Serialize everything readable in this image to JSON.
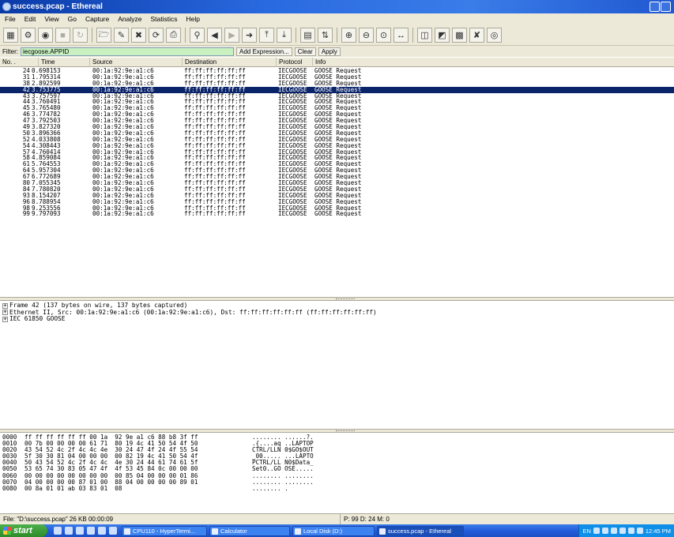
{
  "window": {
    "title": "success.pcap - Ethereal"
  },
  "menu": [
    "File",
    "Edit",
    "View",
    "Go",
    "Capture",
    "Analyze",
    "Statistics",
    "Help"
  ],
  "toolbar": {
    "icons": [
      "interface-list-icon",
      "capture-options-icon",
      "start-capture-icon",
      "stop-capture-icon",
      "restart-capture-icon",
      "open-icon",
      "save-as-icon",
      "close-file-icon",
      "reload-icon",
      "print-icon",
      "find-packet-icon",
      "go-back-icon",
      "go-forward-icon",
      "go-to-packet-icon",
      "go-first-icon",
      "go-last-icon",
      "colorize-icon",
      "auto-scroll-icon",
      "zoom-in-icon",
      "zoom-out-icon",
      "zoom-normal-icon",
      "resize-columns-icon",
      "capture-filters-icon",
      "display-filters-icon",
      "coloring-rules-icon",
      "preferences-icon",
      "help-icon"
    ]
  },
  "filter": {
    "label": "Filter:",
    "value": "iecgoose.APPID",
    "add_expression": "Add Expression...",
    "clear": "Clear",
    "apply": "Apply"
  },
  "columns": [
    "No. .",
    "Time",
    "Source",
    "Destination",
    "Protocol",
    "Info"
  ],
  "packets": [
    {
      "no": "24",
      "time": "0.698153",
      "src": "00:1a:92:9e:a1:c6",
      "dst": "ff:ff:ff:ff:ff:ff",
      "proto": "IECGOOSE",
      "info": "GOOSE Request",
      "selected": false
    },
    {
      "no": "31",
      "time": "1.795314",
      "src": "00:1a:92:9e:a1:c6",
      "dst": "ff:ff:ff:ff:ff:ff",
      "proto": "IECGOOSE",
      "info": "GOOSE Request",
      "selected": false
    },
    {
      "no": "38",
      "time": "2.892599",
      "src": "00:1a:92:9e:a1:c6",
      "dst": "ff:ff:ff:ff:ff:ff",
      "proto": "IECGOOSE",
      "info": "GOOSE Request",
      "selected": false
    },
    {
      "no": "42",
      "time": "3.753775",
      "src": "00:1a:92:9e:a1:c6",
      "dst": "ff:ff:ff:ff:ff:ff",
      "proto": "IECGOOSE",
      "info": "GOOSE Request",
      "selected": true
    },
    {
      "no": "43",
      "time": "3.757597",
      "src": "00:1a:92:9e:a1:c6",
      "dst": "ff:ff:ff:ff:ff:ff",
      "proto": "IECGOOSE",
      "info": "GOOSE Request",
      "selected": false
    },
    {
      "no": "44",
      "time": "3.760491",
      "src": "00:1a:92:9e:a1:c6",
      "dst": "ff:ff:ff:ff:ff:ff",
      "proto": "IECGOOSE",
      "info": "GOOSE Request",
      "selected": false
    },
    {
      "no": "45",
      "time": "3.765480",
      "src": "00:1a:92:9e:a1:c6",
      "dst": "ff:ff:ff:ff:ff:ff",
      "proto": "IECGOOSE",
      "info": "GOOSE Request",
      "selected": false
    },
    {
      "no": "46",
      "time": "3.774782",
      "src": "00:1a:92:9e:a1:c6",
      "dst": "ff:ff:ff:ff:ff:ff",
      "proto": "IECGOOSE",
      "info": "GOOSE Request",
      "selected": false
    },
    {
      "no": "47",
      "time": "3.792503",
      "src": "00:1a:92:9e:a1:c6",
      "dst": "ff:ff:ff:ff:ff:ff",
      "proto": "IECGOOSE",
      "info": "GOOSE Request",
      "selected": false
    },
    {
      "no": "49",
      "time": "3.827320",
      "src": "00:1a:92:9e:a1:c6",
      "dst": "ff:ff:ff:ff:ff:ff",
      "proto": "IECGOOSE",
      "info": "GOOSE Request",
      "selected": false
    },
    {
      "no": "50",
      "time": "3.896366",
      "src": "00:1a:92:9e:a1:c6",
      "dst": "ff:ff:ff:ff:ff:ff",
      "proto": "IECGOOSE",
      "info": "GOOSE Request",
      "selected": false
    },
    {
      "no": "52",
      "time": "4.033808",
      "src": "00:1a:92:9e:a1:c6",
      "dst": "ff:ff:ff:ff:ff:ff",
      "proto": "IECGOOSE",
      "info": "GOOSE Request",
      "selected": false
    },
    {
      "no": "54",
      "time": "4.308443",
      "src": "00:1a:92:9e:a1:c6",
      "dst": "ff:ff:ff:ff:ff:ff",
      "proto": "IECGOOSE",
      "info": "GOOSE Request",
      "selected": false
    },
    {
      "no": "57",
      "time": "4.760414",
      "src": "00:1a:92:9e:a1:c6",
      "dst": "ff:ff:ff:ff:ff:ff",
      "proto": "IECGOOSE",
      "info": "GOOSE Request",
      "selected": false
    },
    {
      "no": "58",
      "time": "4.859084",
      "src": "00:1a:92:9e:a1:c6",
      "dst": "ff:ff:ff:ff:ff:ff",
      "proto": "IECGOOSE",
      "info": "GOOSE Request",
      "selected": false
    },
    {
      "no": "61",
      "time": "5.764553",
      "src": "00:1a:92:9e:a1:c6",
      "dst": "ff:ff:ff:ff:ff:ff",
      "proto": "IECGOOSE",
      "info": "GOOSE Request",
      "selected": false
    },
    {
      "no": "64",
      "time": "5.957304",
      "src": "00:1a:92:9e:a1:c6",
      "dst": "ff:ff:ff:ff:ff:ff",
      "proto": "IECGOOSE",
      "info": "GOOSE Request",
      "selected": false
    },
    {
      "no": "67",
      "time": "6.772689",
      "src": "00:1a:92:9e:a1:c6",
      "dst": "ff:ff:ff:ff:ff:ff",
      "proto": "IECGOOSE",
      "info": "GOOSE Request",
      "selected": false
    },
    {
      "no": "80",
      "time": "7.055345",
      "src": "00:1a:92:9e:a1:c6",
      "dst": "ff:ff:ff:ff:ff:ff",
      "proto": "IECGOOSE",
      "info": "GOOSE Request",
      "selected": false
    },
    {
      "no": "84",
      "time": "7.780820",
      "src": "00:1a:92:9e:a1:c6",
      "dst": "ff:ff:ff:ff:ff:ff",
      "proto": "IECGOOSE",
      "info": "GOOSE Request",
      "selected": false
    },
    {
      "no": "93",
      "time": "8.154207",
      "src": "00:1a:92:9e:a1:c6",
      "dst": "ff:ff:ff:ff:ff:ff",
      "proto": "IECGOOSE",
      "info": "GOOSE Request",
      "selected": false
    },
    {
      "no": "96",
      "time": "8.788954",
      "src": "00:1a:92:9e:a1:c6",
      "dst": "ff:ff:ff:ff:ff:ff",
      "proto": "IECGOOSE",
      "info": "GOOSE Request",
      "selected": false
    },
    {
      "no": "98",
      "time": "9.253556",
      "src": "00:1a:92:9e:a1:c6",
      "dst": "ff:ff:ff:ff:ff:ff",
      "proto": "IECGOOSE",
      "info": "GOOSE Request",
      "selected": false
    },
    {
      "no": "99",
      "time": "9.797093",
      "src": "00:1a:92:9e:a1:c6",
      "dst": "ff:ff:ff:ff:ff:ff",
      "proto": "IECGOOSE",
      "info": "GOOSE Request",
      "selected": false
    }
  ],
  "details": [
    {
      "expander": "⊞",
      "text": "Frame 42 (137 bytes on wire, 137 bytes captured)"
    },
    {
      "expander": "⊞",
      "text": "Ethernet II, Src: 00:1a:92:9e:a1:c6 (00:1a:92:9e:a1:c6), Dst: ff:ff:ff:ff:ff:ff (ff:ff:ff:ff:ff:ff)"
    },
    {
      "expander": "⊞",
      "text": "IEC 61850 GOOSE"
    }
  ],
  "bytes": [
    {
      "offset": "0000",
      "hex": "ff ff ff ff ff ff 00 1a  92 9e a1 c6 88 b8 3f ff",
      "ascii": "........ ......?."
    },
    {
      "offset": "0010",
      "hex": "00 7b 00 00 00 00 61 71  80 19 4c 41 50 54 4f 50",
      "ascii": ".{....aq ..LAPTOP"
    },
    {
      "offset": "0020",
      "hex": "43 54 52 4c 2f 4c 4c 4e  30 24 47 4f 24 4f 55 54",
      "ascii": "CTRL/LLN 0$GO$OUT"
    },
    {
      "offset": "0030",
      "hex": "5f 30 30 81 04 00 00 00  00 82 19 4c 41 50 54 4f",
      "ascii": "_00..... ...LAPTO"
    },
    {
      "offset": "0040",
      "hex": "50 43 54 52 4c 2f 4c 4c  4e 30 24 44 61 74 61 5f",
      "ascii": "PCTRL/LL N0$Data_"
    },
    {
      "offset": "0050",
      "hex": "53 65 74 30 83 05 47 4f  4f 53 45 84 0c 00 00 00",
      "ascii": "Set0..GO OSE....."
    },
    {
      "offset": "0060",
      "hex": "00 00 00 00 00 00 00 00  00 85 04 00 00 00 01 86",
      "ascii": "........ ........"
    },
    {
      "offset": "0070",
      "hex": "04 00 00 00 00 87 01 00  88 04 00 00 00 00 89 01",
      "ascii": "........ ........"
    },
    {
      "offset": "0080",
      "hex": "00 8a 01 01 ab 03 83 01  08",
      "ascii": "........ ."
    }
  ],
  "status": {
    "file": "File: \"D:\\success.pcap\" 26 KB 00:00:09",
    "counts": "P: 99 D: 24 M: 0"
  },
  "taskbar": {
    "start": "start",
    "tasks": [
      {
        "label": "CPU110 - HyperTermi...",
        "active": false
      },
      {
        "label": "Calculator",
        "active": false
      },
      {
        "label": "Local Disk (D:)",
        "active": false
      },
      {
        "label": "success.pcap - Ethereal",
        "active": true
      }
    ],
    "clock": "12:45 PM",
    "lang": "EN"
  }
}
